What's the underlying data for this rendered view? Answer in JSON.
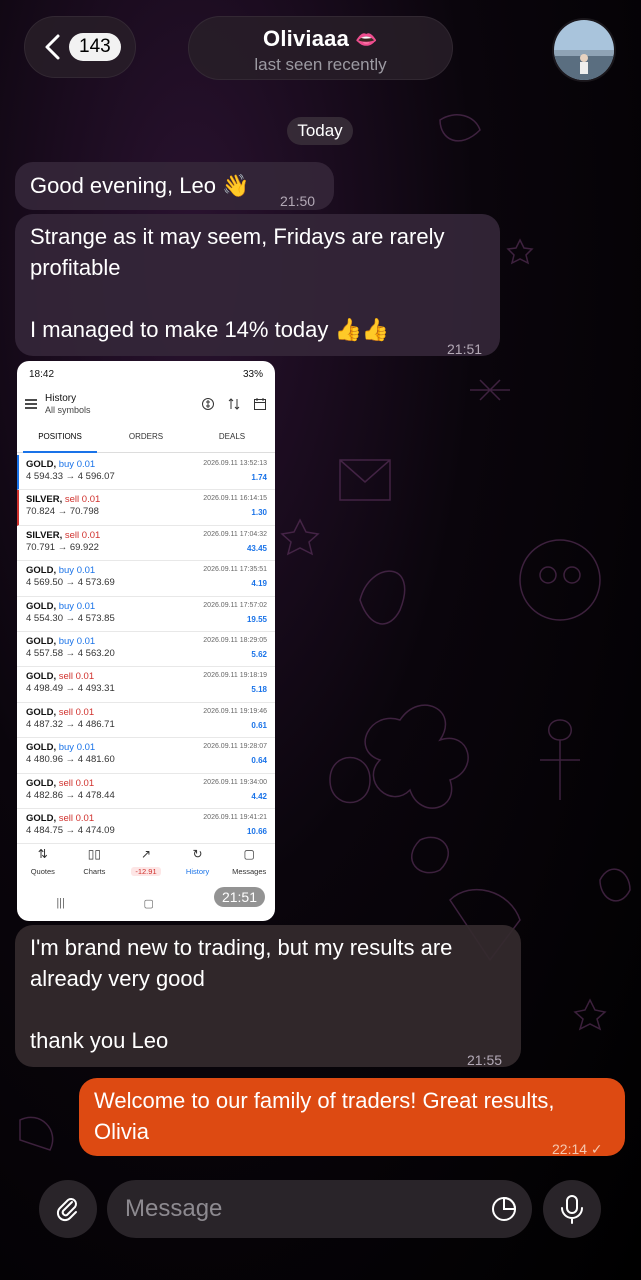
{
  "header": {
    "back_count": "143",
    "contact_name": "Oliviaaa",
    "contact_emoji": "👄",
    "status": "last seen recently"
  },
  "date_chip": "Today",
  "messages": [
    {
      "text": "Good evening, Leo 👋",
      "time": "21:50"
    },
    {
      "text": "Strange as it may seem, Fridays are rarely profitable\n\nI managed to make 14% today 👍👍",
      "time": "21:51"
    },
    {
      "text": "I'm brand new to trading, but my results are already very good\n\nthank you Leo",
      "time": "21:55"
    },
    {
      "text": "Welcome to our family of traders! Great results, Olivia",
      "time": "22:14 ✓"
    }
  ],
  "screenshot": {
    "time": "21:51",
    "status_time": "18:42",
    "battery": "33%",
    "title": "History",
    "subtitle": "All symbols",
    "tabs": [
      "POSITIONS",
      "ORDERS",
      "DEALS"
    ],
    "rows": [
      {
        "symbol": "GOLD,",
        "side": "buy",
        "lot": "buy 0.01",
        "prices": "4 594.33 → 4 596.07",
        "date": "2026.09.11 13:52:13",
        "profit": "1.74"
      },
      {
        "symbol": "SILVER,",
        "side": "sell",
        "lot": "sell 0.01",
        "prices": "70.824 → 70.798",
        "date": "2026.09.11 16:14:15",
        "profit": "1.30"
      },
      {
        "symbol": "SILVER,",
        "side": "sell",
        "lot": "sell 0.01",
        "prices": "70.791 → 69.922",
        "date": "2026.09.11 17:04:32",
        "profit": "43.45"
      },
      {
        "symbol": "GOLD,",
        "side": "buy",
        "lot": "buy 0.01",
        "prices": "4 569.50 → 4 573.69",
        "date": "2026.09.11 17:35:51",
        "profit": "4.19"
      },
      {
        "symbol": "GOLD,",
        "side": "buy",
        "lot": "buy 0.01",
        "prices": "4 554.30 → 4 573.85",
        "date": "2026.09.11 17:57:02",
        "profit": "19.55"
      },
      {
        "symbol": "GOLD,",
        "side": "buy",
        "lot": "buy 0.01",
        "prices": "4 557.58 → 4 563.20",
        "date": "2026.09.11 18:29:05",
        "profit": "5.62"
      },
      {
        "symbol": "GOLD,",
        "side": "sell",
        "lot": "sell 0.01",
        "prices": "4 498.49 → 4 493.31",
        "date": "2026.09.11 19:18:19",
        "profit": "5.18"
      },
      {
        "symbol": "GOLD,",
        "side": "sell",
        "lot": "sell 0.01",
        "prices": "4 487.32 → 4 486.71",
        "date": "2026.09.11 19:19:46",
        "profit": "0.61"
      },
      {
        "symbol": "GOLD,",
        "side": "buy",
        "lot": "buy 0.01",
        "prices": "4 480.96 → 4 481.60",
        "date": "2026.09.11 19:28:07",
        "profit": "0.64"
      },
      {
        "symbol": "GOLD,",
        "side": "sell",
        "lot": "sell 0.01",
        "prices": "4 482.86 → 4 478.44",
        "date": "2026.09.11 19:34:00",
        "profit": "4.42"
      },
      {
        "symbol": "GOLD,",
        "side": "sell",
        "lot": "sell 0.01",
        "prices": "4 484.75 → 4 474.09",
        "date": "2026.09.11 19:41:21",
        "profit": "10.66"
      }
    ],
    "nav": [
      "Quotes",
      "Charts",
      "-12.91",
      "History",
      "Messages"
    ]
  },
  "input": {
    "placeholder": "Message"
  },
  "colors": {
    "outgoing": "#dd4a12",
    "incoming": "#34263a",
    "accent": "#1a73e8"
  }
}
